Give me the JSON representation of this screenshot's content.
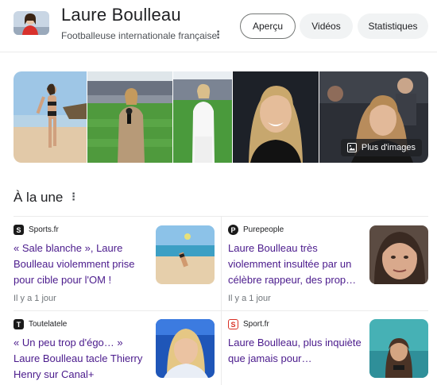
{
  "header": {
    "title": "Laure Boulleau",
    "subtitle": "Footballeuse internationale française",
    "more_icon": "⋮",
    "tabs": [
      {
        "label": "Aperçu",
        "active": true
      },
      {
        "label": "Vidéos",
        "active": false
      },
      {
        "label": "Statistiques",
        "active": false
      }
    ]
  },
  "images": {
    "more_label": "Plus d'images"
  },
  "news": {
    "title": "À la une",
    "more_icon": "⋮",
    "items": [
      {
        "source": "Sports.fr",
        "headline": "« Sale blanche », Laure Boulleau violemment prise pour cible pour l'OM !",
        "time": "Il y a 1 jour"
      },
      {
        "source": "Purepeople",
        "headline": "Laure Boulleau très violemment insultée par un célèbre rappeur, des prop…",
        "time": "Il y a 1 jour"
      },
      {
        "source": "Toutelatele",
        "headline": "« Un peu trop d'égo… » Laure Boulleau tacle Thierry Henry sur Canal+",
        "time": ""
      },
      {
        "source": "Sport.fr",
        "headline": "Laure Boulleau, plus inquiète que jamais pour…",
        "time": ""
      }
    ]
  },
  "colors": {
    "headline_link": "#4a1a8c",
    "border": "#ebebeb",
    "chip_bg": "#f1f3f4"
  }
}
